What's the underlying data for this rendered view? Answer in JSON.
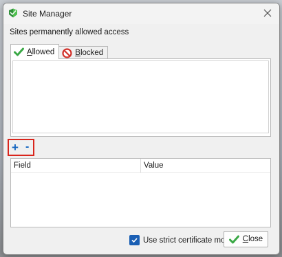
{
  "window": {
    "title": "Site Manager",
    "icon": "site-manager-shield-icon",
    "close_icon": "close-icon"
  },
  "header": {
    "description": "Sites permanently allowed access"
  },
  "tabs": [
    {
      "label_first": "A",
      "label_rest": "llowed",
      "icon": "checkmark-icon",
      "active": true
    },
    {
      "label_first": "B",
      "label_rest": "locked",
      "icon": "blocked-icon",
      "active": false
    }
  ],
  "sites_list": {
    "items": []
  },
  "toolbar": {
    "add_label": "+",
    "remove_label": "-"
  },
  "properties": {
    "columns": [
      "Field",
      "Value"
    ],
    "rows": []
  },
  "footer": {
    "strict_mode_label": "Use strict certificate mode",
    "strict_mode_checked": true,
    "close_label_first": "C",
    "close_label_rest": "lose"
  },
  "colors": {
    "accent_blue": "#1565c0",
    "highlight_red": "#d9251c",
    "check_green": "#3aa845",
    "blocked_red": "#d2312a"
  }
}
